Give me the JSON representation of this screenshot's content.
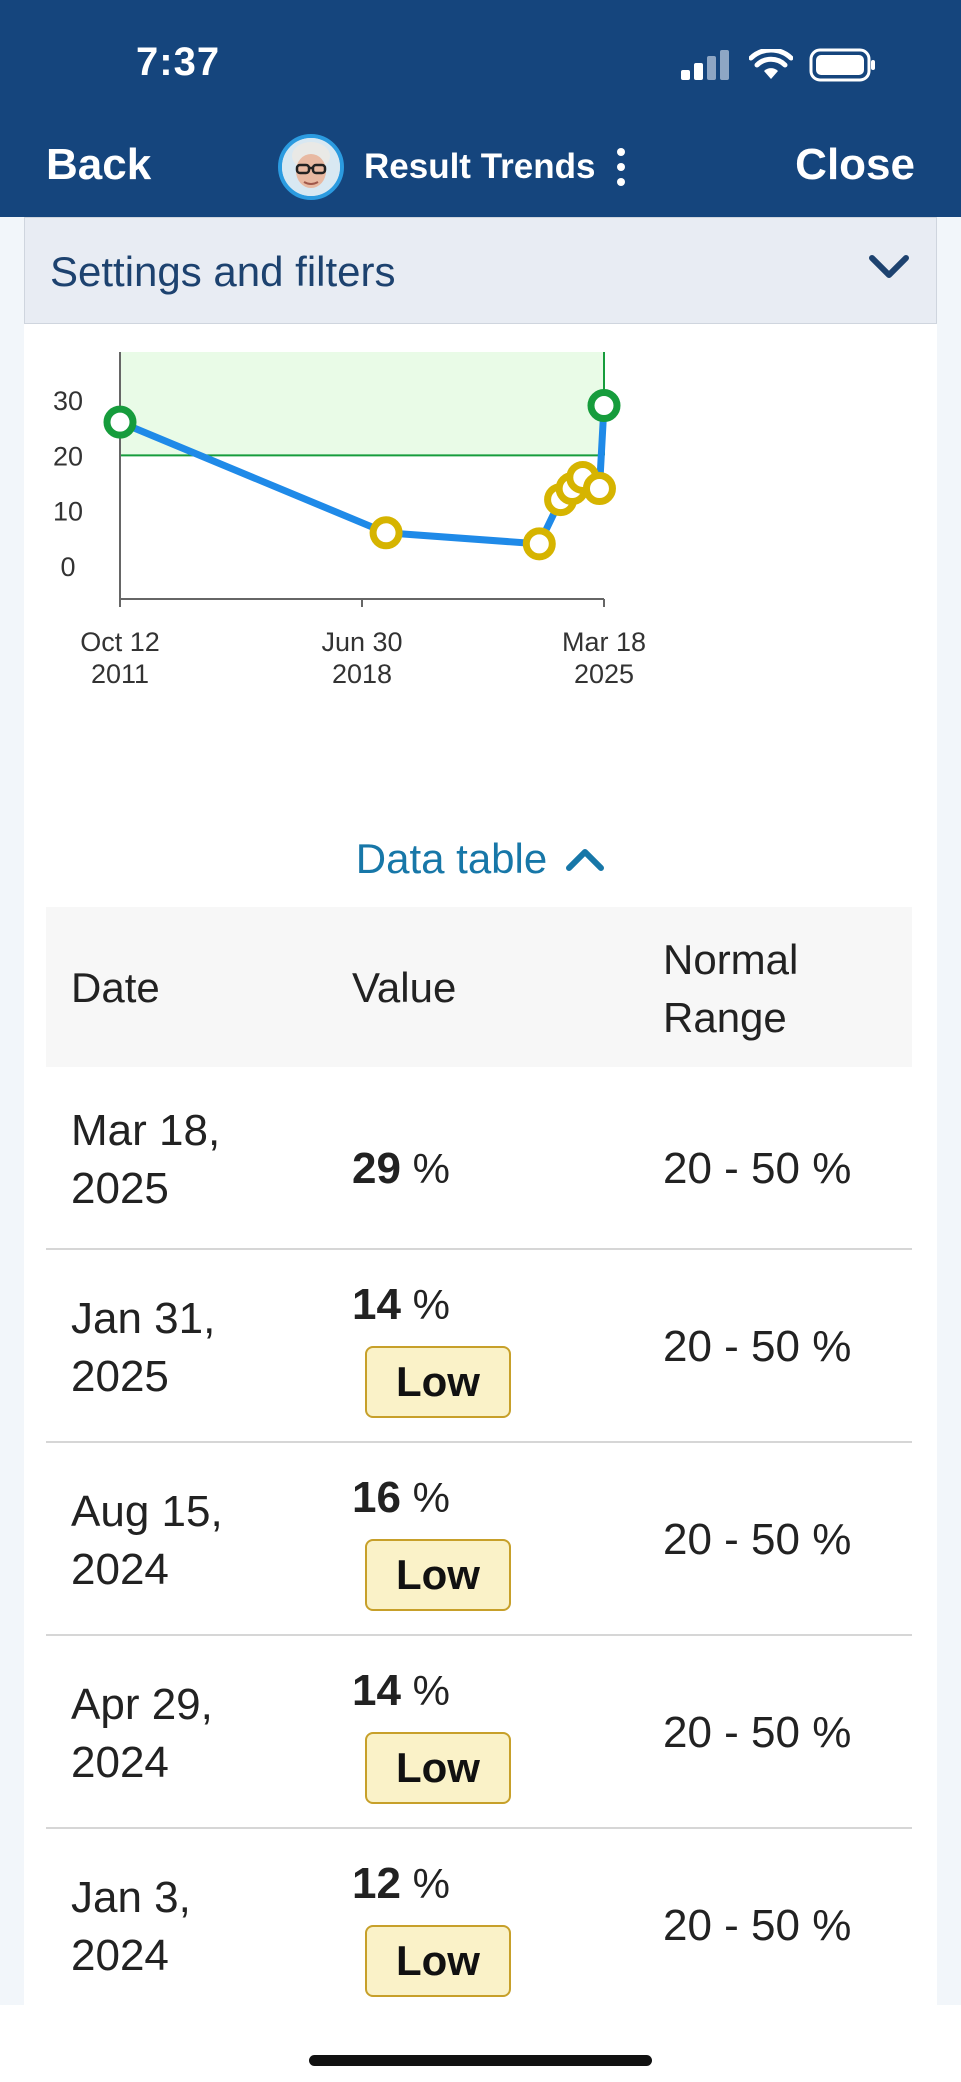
{
  "status_bar": {
    "time": "7:37"
  },
  "nav": {
    "back_label": "Back",
    "title": "Result Trends",
    "close_label": "Close"
  },
  "settings": {
    "label": "Settings and filters"
  },
  "chart_data": {
    "type": "line",
    "y_ticks": [
      "30",
      "20",
      "10",
      "0"
    ],
    "x_ticks": [
      {
        "line1": "Oct 12",
        "line2": "2011"
      },
      {
        "line1": "Jun 30",
        "line2": "2018"
      },
      {
        "line1": "Mar 18",
        "line2": "2025"
      }
    ],
    "normal_range": [
      20,
      50
    ],
    "ylim": [
      0,
      36
    ],
    "series": [
      {
        "points": [
          {
            "x": "2011-10-12",
            "y": 26,
            "status": "normal"
          },
          {
            "x": "2019-03-01",
            "y": 6,
            "status": "low"
          },
          {
            "x": "2023-06-01",
            "y": 4,
            "status": "low"
          },
          {
            "x": "2024-01-03",
            "y": 12,
            "status": "low"
          },
          {
            "x": "2024-04-29",
            "y": 14,
            "status": "low"
          },
          {
            "x": "2024-08-15",
            "y": 16,
            "status": "low"
          },
          {
            "x": "2025-01-31",
            "y": 14,
            "status": "low"
          },
          {
            "x": "2025-03-18",
            "y": 29,
            "status": "normal"
          }
        ]
      }
    ]
  },
  "data_table": {
    "toggle_label": "Data table",
    "headers": {
      "date": "Date",
      "value": "Value",
      "range_line1": "Normal",
      "range_line2": "Range"
    },
    "rows": [
      {
        "date_line1": "Mar 18,",
        "date_line2": "2025",
        "value": "29",
        "unit": "%",
        "flag": "",
        "range": "20 - 50 %"
      },
      {
        "date_line1": "Jan 31,",
        "date_line2": "2025",
        "value": "14",
        "unit": "%",
        "flag": "Low",
        "range": "20 - 50 %"
      },
      {
        "date_line1": "Aug 15,",
        "date_line2": "2024",
        "value": "16",
        "unit": "%",
        "flag": "Low",
        "range": "20 - 50 %"
      },
      {
        "date_line1": "Apr 29,",
        "date_line2": "2024",
        "value": "14",
        "unit": "%",
        "flag": "Low",
        "range": "20 - 50 %"
      },
      {
        "date_line1": "Jan 3,",
        "date_line2": "2024",
        "value": "12",
        "unit": "%",
        "flag": "Low",
        "range": "20 - 50 %"
      }
    ]
  },
  "colors": {
    "header_bg": "#15457d",
    "line": "#1f8ae8",
    "normal_marker": "#169c3c",
    "low_marker": "#d6b400",
    "range_band": "#e9fbe7",
    "link": "#1777a8"
  }
}
